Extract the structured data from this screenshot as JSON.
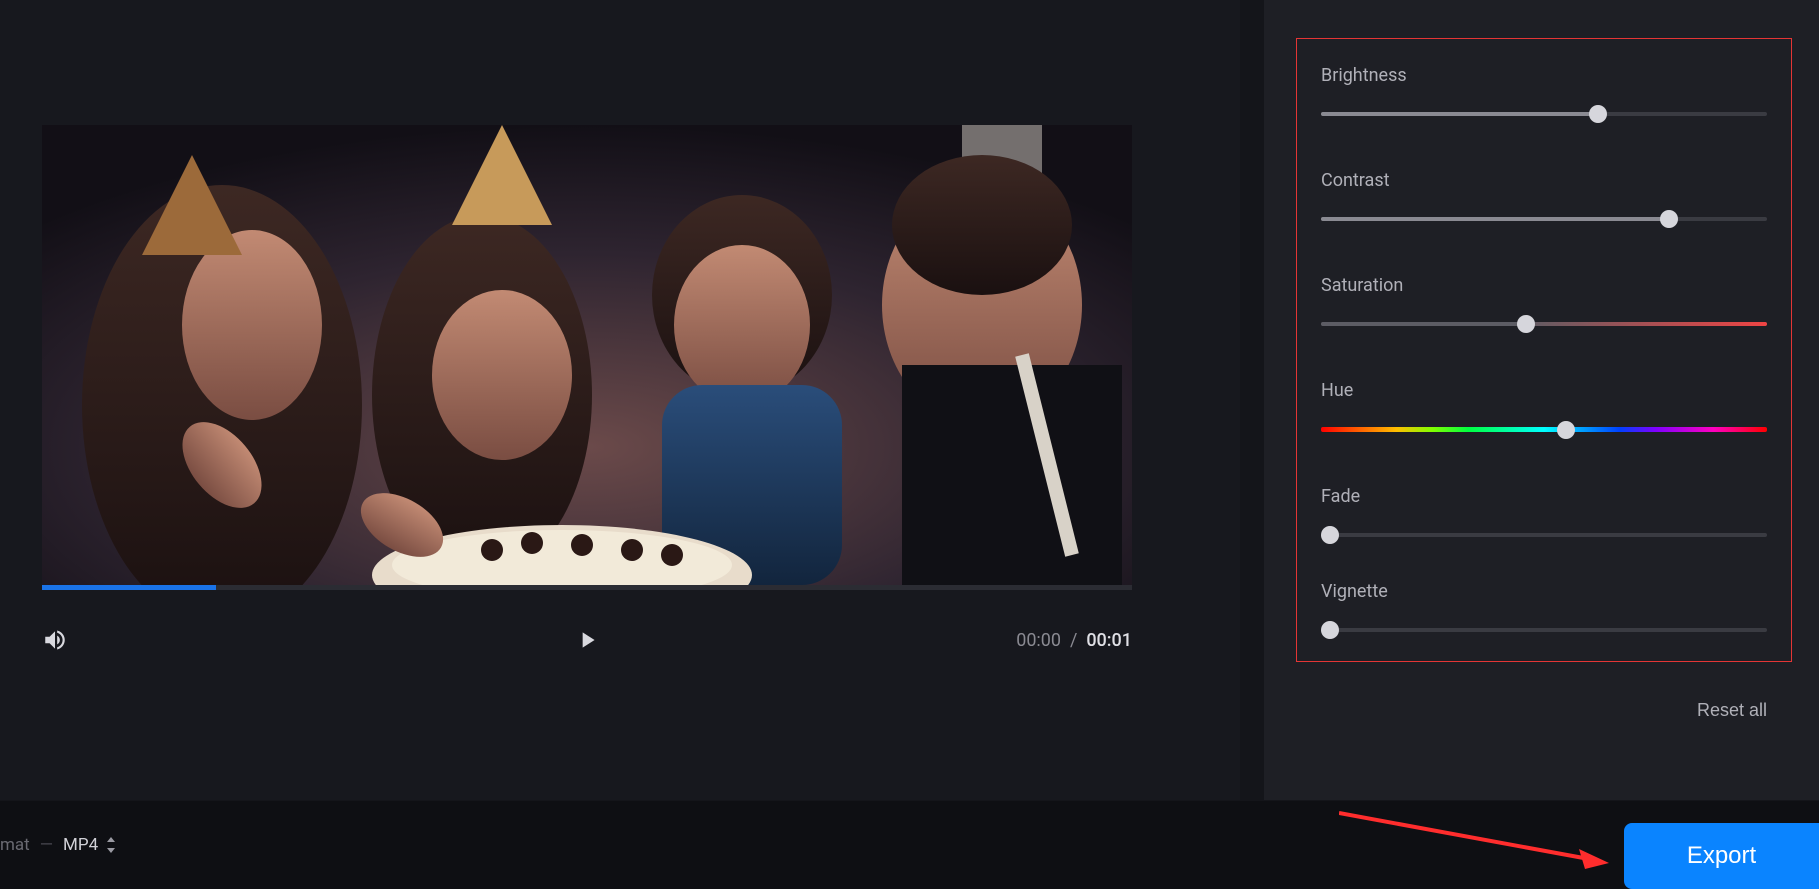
{
  "player": {
    "current_time": "00:00",
    "total_time": "00:01",
    "separator": "/",
    "progress_percent": 16
  },
  "adjust": {
    "brightness": {
      "label": "Brightness",
      "value": 62
    },
    "contrast": {
      "label": "Contrast",
      "value": 78
    },
    "saturation": {
      "label": "Saturation",
      "value": 46
    },
    "hue": {
      "label": "Hue",
      "value": 55
    },
    "fade": {
      "label": "Fade",
      "value": 2
    },
    "vignette": {
      "label": "Vignette",
      "value": 2
    }
  },
  "reset_label": "Reset all",
  "footer": {
    "format_label": "mat",
    "dash": "—",
    "format_value": "MP4",
    "export_label": "Export"
  },
  "colors": {
    "accent": "#0a84ff",
    "highlight_border": "#e43535"
  }
}
